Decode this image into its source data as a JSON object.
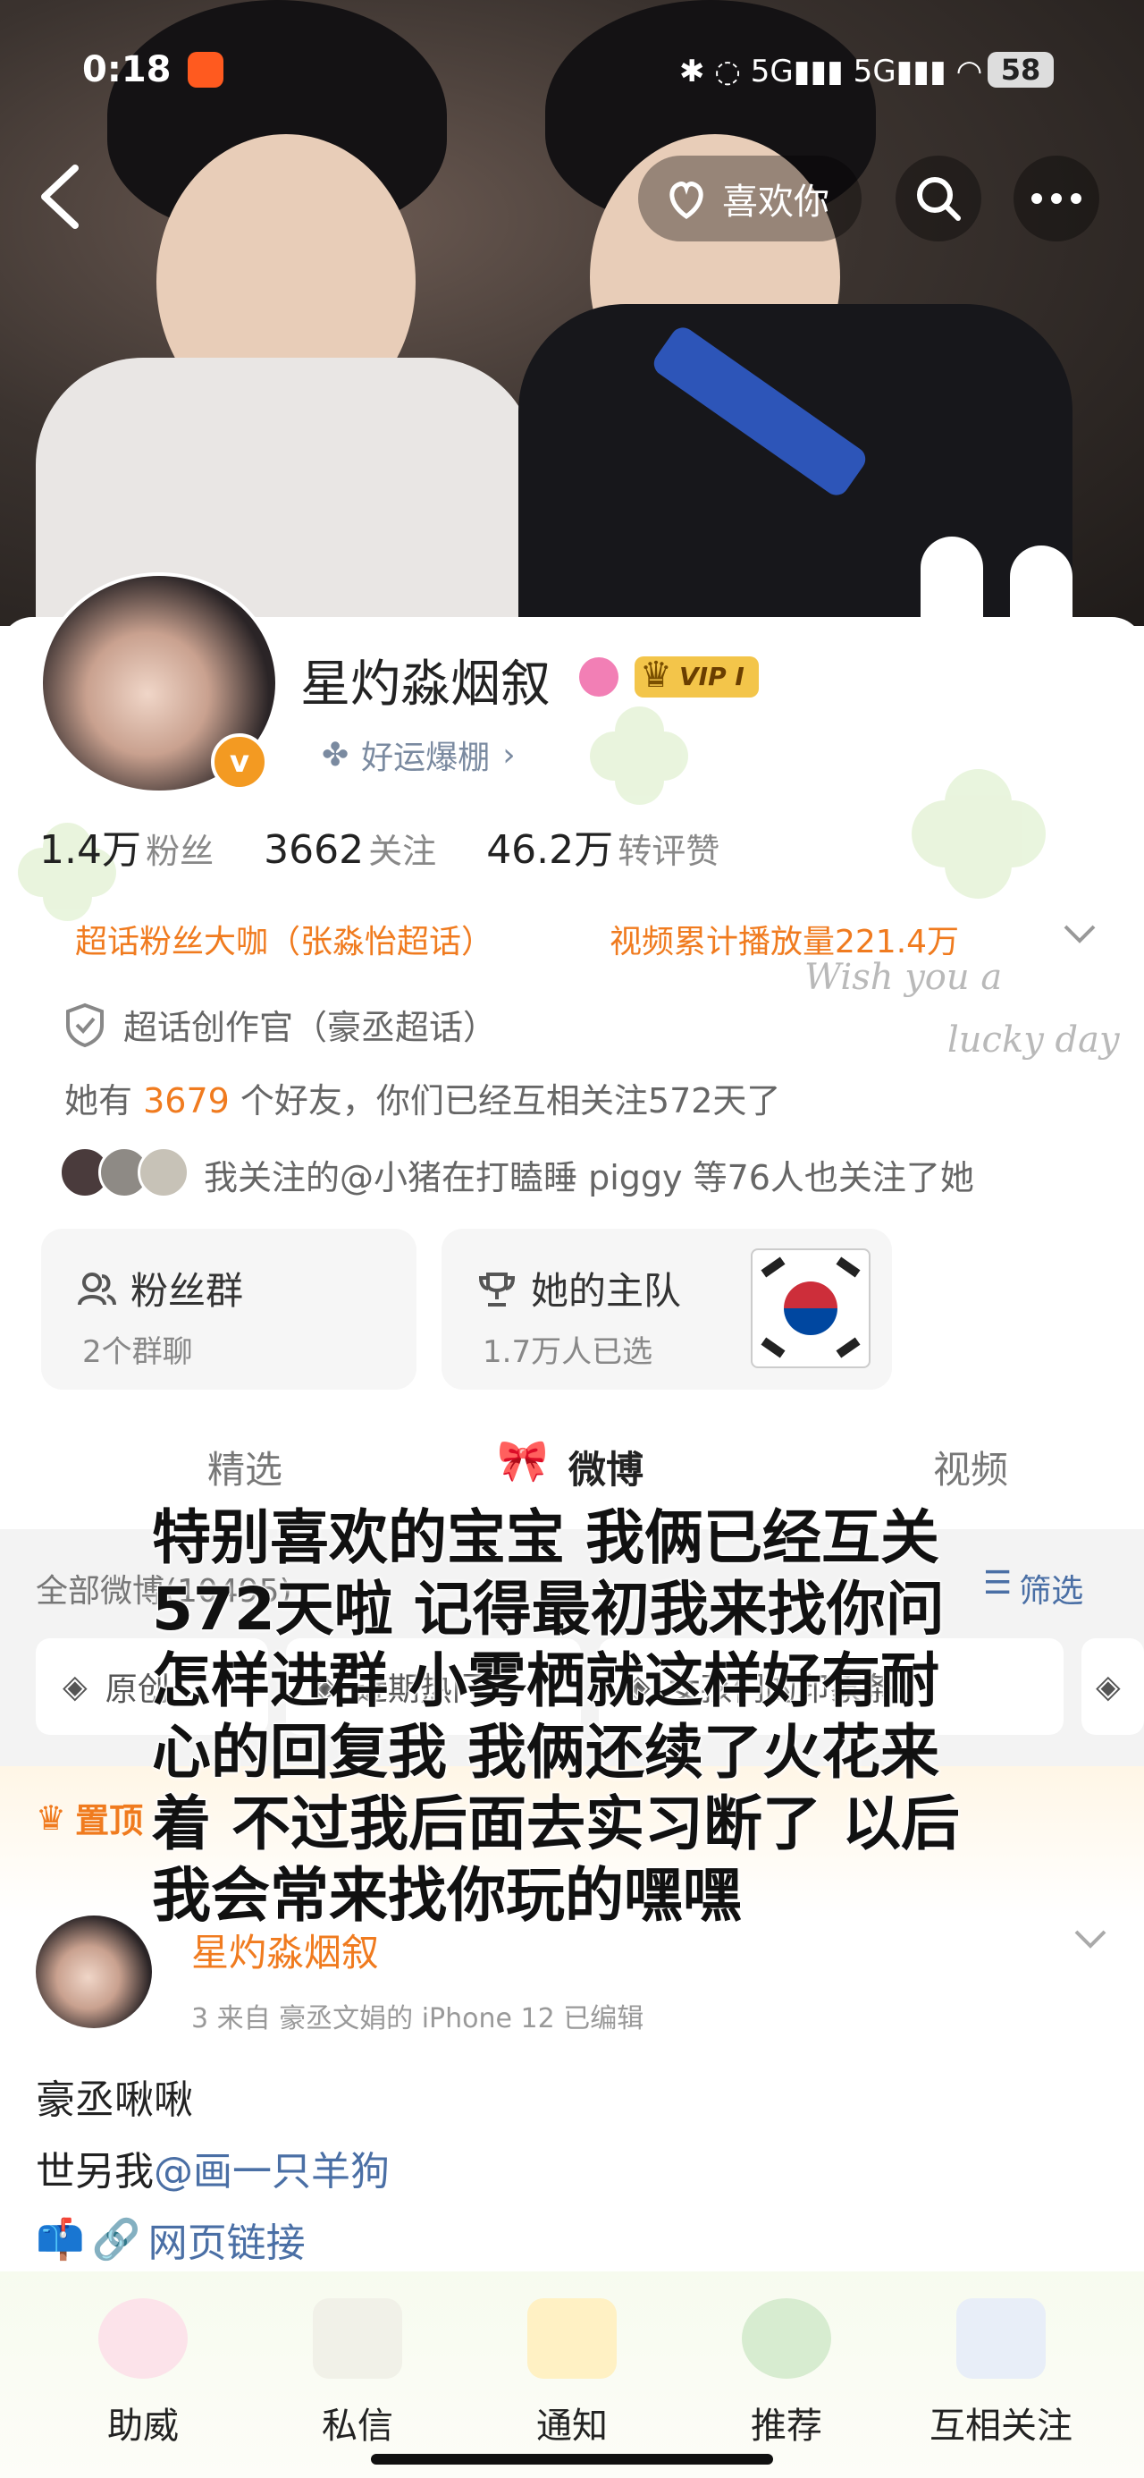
{
  "status_bar": {
    "time": "0:18",
    "battery": "58"
  },
  "header": {
    "like_label": "喜欢你"
  },
  "profile": {
    "name": "星灼淼烟叙",
    "vip_badge": "VIP I",
    "tagline": "好运爆棚",
    "tagline_chevron": "›",
    "stats": [
      {
        "value": "1.4万",
        "label": "粉丝"
      },
      {
        "value": "3662",
        "label": "关注"
      },
      {
        "value": "46.2万",
        "label": "转评赞"
      }
    ],
    "super_topic_fan": "超话粉丝大咖（张淼怡超话）",
    "video_plays": "视频累计播放量221.4万",
    "creator_title": "超话创作官（豪丞超话）",
    "friends_pre": "她有 ",
    "friends_count": "3679",
    "friends_post": " 个好友，你们已经互相关注572天了",
    "mutual_follow": "我关注的@小猪在打瞌睡 piggy 等76人也关注了她",
    "decor_text_1": "Wish you a",
    "decor_text_2": "lucky day"
  },
  "cards": {
    "fan_group_title": "粉丝群",
    "fan_group_sub": "2个群聊",
    "main_team_title": "她的主队",
    "main_team_sub": "1.7万人已选"
  },
  "tabs": [
    "精选",
    "微博",
    "视频"
  ],
  "feed": {
    "all_posts": "全部微博(10495)",
    "filter": "筛选",
    "chips": [
      "原创",
      "近期热门",
      "女孩们的印象条"
    ],
    "pinned": "置顶",
    "post_author": "星灼淼烟叙",
    "post_meta": "3 来自 豪丞文娟的 iPhone 12 已编辑",
    "post_line1": "豪丞啾啾",
    "post_line2_pre": "世另我",
    "post_line2_mention": "@画一只羊狗",
    "post_link": "网页链接"
  },
  "overlay_lines": [
    "特别喜欢的宝宝 我俩已经互关",
    "572天啦 记得最初我来找你问",
    "怎样进群 小雾栖就这样好有耐",
    "心的回复我 我俩还续了火花来",
    "着 不过我后面去实习断了 以后",
    "我会常来找你玩的嘿嘿"
  ],
  "bottom_nav": [
    "助威",
    "私信",
    "通知",
    "推荐",
    "互相关注"
  ],
  "colors": {
    "accent_orange": "#f07b1f",
    "link_blue": "#4a6fa5",
    "vip_gold": "#f3c54a"
  }
}
